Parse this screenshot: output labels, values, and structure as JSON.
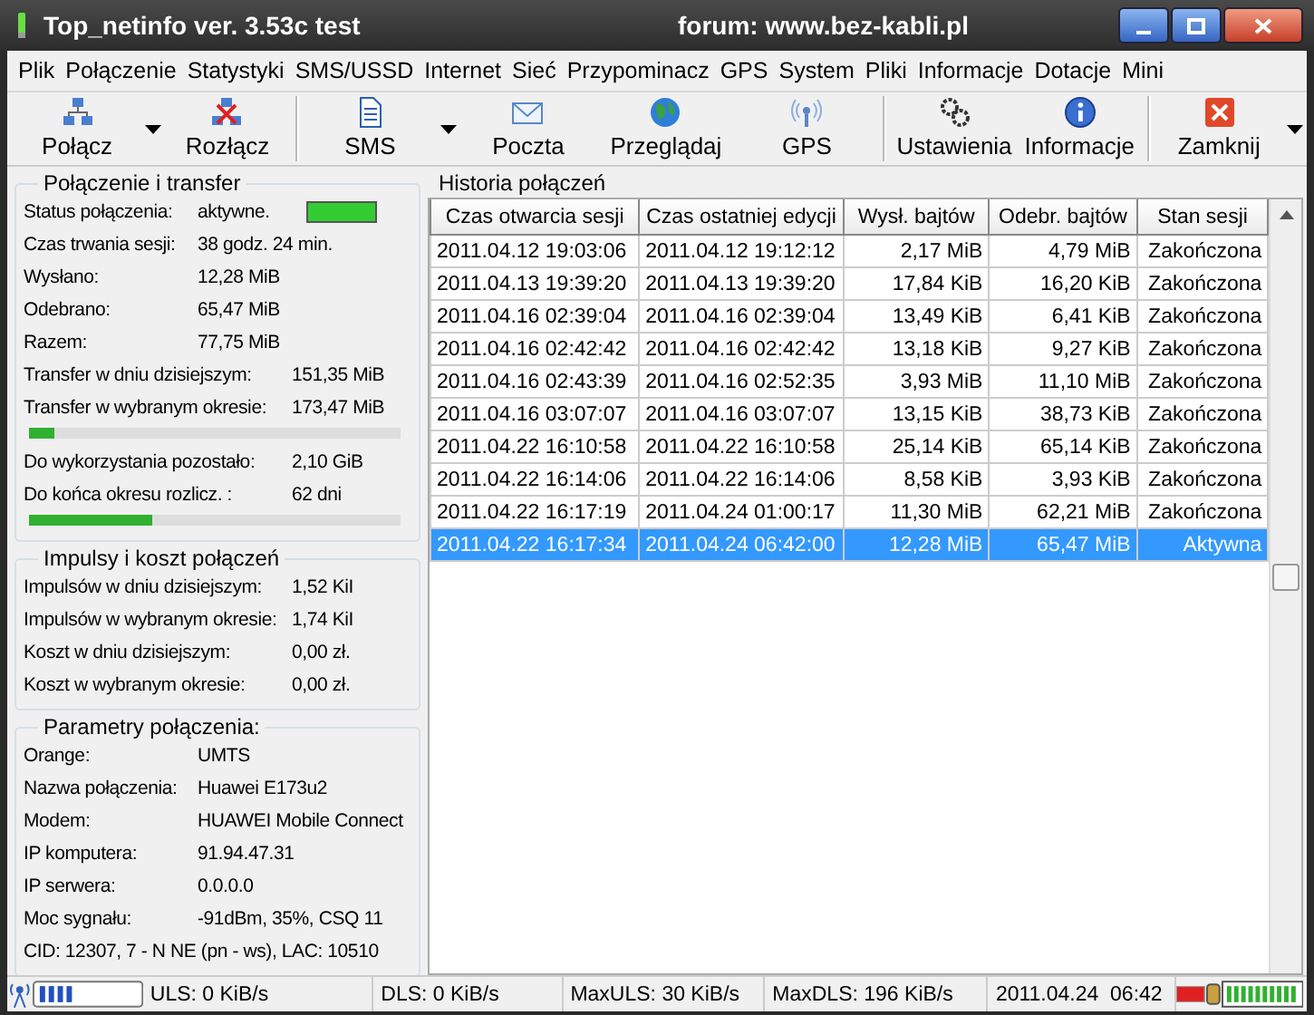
{
  "window": {
    "title": "Top_netinfo ver. 3.53c test",
    "subtitle": "forum: www.bez-kabli.pl"
  },
  "menu": [
    "Plik",
    "Połączenie",
    "Statystyki",
    "SMS/USSD",
    "Internet",
    "Sieć",
    "Przypominacz",
    "GPS",
    "System",
    "Pliki",
    "Informacje",
    "Dotacje",
    "Mini"
  ],
  "toolbar": [
    {
      "label": "Połącz",
      "kind": "connect",
      "dropdown": true,
      "separator_after": false
    },
    {
      "label": "Rozłącz",
      "kind": "disconnect",
      "dropdown": false,
      "separator_after": true
    },
    {
      "label": "SMS",
      "kind": "sms",
      "dropdown": true,
      "separator_after": false
    },
    {
      "label": "Poczta",
      "kind": "mail",
      "dropdown": false,
      "separator_after": false
    },
    {
      "label": "Przeglądaj",
      "kind": "browse",
      "dropdown": false,
      "separator_after": false
    },
    {
      "label": "GPS",
      "kind": "gps",
      "dropdown": false,
      "separator_after": true
    },
    {
      "label": "Ustawienia",
      "kind": "settings",
      "dropdown": false,
      "separator_after": false
    },
    {
      "label": "Informacje",
      "kind": "info",
      "dropdown": false,
      "separator_after": true
    },
    {
      "label": "Zamknij",
      "kind": "close",
      "dropdown": true,
      "separator_after": false
    }
  ],
  "groups": [
    {
      "title": "Połączenie i transfer",
      "rows": [
        {
          "kind": "status",
          "label": "Status połączenia:",
          "value": "aktywne.",
          "color": "#33cc33"
        },
        {
          "kind": "pair",
          "label": "Czas trwania sesji:",
          "value": "38 godz. 24 min."
        },
        {
          "kind": "pair",
          "label": "Wysłano:",
          "value": "12,28 MiB"
        },
        {
          "kind": "pair",
          "label": "Odebrano:",
          "value": "65,47 MiB"
        },
        {
          "kind": "pair",
          "label": "Razem:",
          "value": "77,75 MiB"
        },
        {
          "kind": "wide",
          "label": "Transfer w dniu dzisiejszym:",
          "value": "151,35 MiB"
        },
        {
          "kind": "wide",
          "label": "Transfer w wybranym okresie:",
          "value": "173,47 MiB"
        },
        {
          "kind": "bar",
          "level": 0.07
        },
        {
          "kind": "wide",
          "label": "Do wykorzystania pozostało:",
          "value": "2,10 GiB"
        },
        {
          "kind": "wide",
          "label": "Do końca okresu rozlicz. :",
          "value": "62 dni"
        },
        {
          "kind": "bar",
          "level": 0.33
        }
      ]
    },
    {
      "title": "Impulsy i koszt połączeń",
      "rows": [
        {
          "kind": "wide",
          "label": "Impulsów w dniu dzisiejszym:",
          "value": "1,52 KiI"
        },
        {
          "kind": "wide",
          "label": "Impulsów w wybranym okresie:",
          "value": "1,74 KiI"
        },
        {
          "kind": "wide",
          "label": "Koszt w dniu dzisiejszym:",
          "value": "0,00 zł."
        },
        {
          "kind": "wide",
          "label": "Koszt w wybranym okresie:",
          "value": "0,00 zł."
        }
      ]
    },
    {
      "title": "Parametry połączenia:",
      "rows": [
        {
          "kind": "pair",
          "label": "Orange:",
          "value": "UMTS"
        },
        {
          "kind": "pair",
          "label": "Nazwa połączenia:",
          "value": "Huawei E173u2"
        },
        {
          "kind": "pair",
          "label": "Modem:",
          "value": "HUAWEI Mobile Connect"
        },
        {
          "kind": "pair",
          "label": "IP komputera:",
          "value": "91.94.47.31"
        },
        {
          "kind": "pair",
          "label": "IP serwera:",
          "value": "0.0.0.0"
        },
        {
          "kind": "pair",
          "label": "Moc sygnału:",
          "value": "-91dBm, 35%, CSQ 11"
        },
        {
          "kind": "line",
          "label": "CID: 12307, 7 - N NE (pn - ws), LAC: 10510"
        }
      ]
    }
  ],
  "history": {
    "title": "Historia połączeń",
    "columns": [
      "Czas otwarcia sesji",
      "Czas ostatniej edycji",
      "Wysł. bajtów",
      "Odebr. bajtów",
      "Stan sesji"
    ],
    "rows": [
      {
        "selected": false,
        "cells": [
          "2011.04.12 19:03:06",
          "2011.04.12 19:12:12",
          "2,17 MiB",
          "4,79 MiB",
          "Zakończona"
        ]
      },
      {
        "selected": false,
        "cells": [
          "2011.04.13 19:39:20",
          "2011.04.13 19:39:20",
          "17,84 KiB",
          "16,20 KiB",
          "Zakończona"
        ]
      },
      {
        "selected": false,
        "cells": [
          "2011.04.16 02:39:04",
          "2011.04.16 02:39:04",
          "13,49 KiB",
          "6,41 KiB",
          "Zakończona"
        ]
      },
      {
        "selected": false,
        "cells": [
          "2011.04.16 02:42:42",
          "2011.04.16 02:42:42",
          "13,18 KiB",
          "9,27 KiB",
          "Zakończona"
        ]
      },
      {
        "selected": false,
        "cells": [
          "2011.04.16 02:43:39",
          "2011.04.16 02:52:35",
          "3,93 MiB",
          "11,10 MiB",
          "Zakończona"
        ]
      },
      {
        "selected": false,
        "cells": [
          "2011.04.16 03:07:07",
          "2011.04.16 03:07:07",
          "13,15 KiB",
          "38,73 KiB",
          "Zakończona"
        ]
      },
      {
        "selected": false,
        "cells": [
          "2011.04.22 16:10:58",
          "2011.04.22 16:10:58",
          "25,14 KiB",
          "65,14 KiB",
          "Zakończona"
        ]
      },
      {
        "selected": false,
        "cells": [
          "2011.04.22 16:14:06",
          "2011.04.22 16:14:06",
          "8,58 KiB",
          "3,93 KiB",
          "Zakończona"
        ]
      },
      {
        "selected": false,
        "cells": [
          "2011.04.22 16:17:19",
          "2011.04.24 01:00:17",
          "11,30 MiB",
          "62,21 MiB",
          "Zakończona"
        ]
      },
      {
        "selected": true,
        "cells": [
          "2011.04.22 16:17:34",
          "2011.04.24 06:42:00",
          "12,28 MiB",
          "65,47 MiB",
          "Aktywna"
        ]
      }
    ]
  },
  "status_bar": [
    "ULS: 0 KiB/s",
    "DLS: 0 KiB/s",
    "MaxULS: 30 KiB/s",
    "MaxDLS: 196 KiB/s",
    "2011.04.24  06:42"
  ]
}
